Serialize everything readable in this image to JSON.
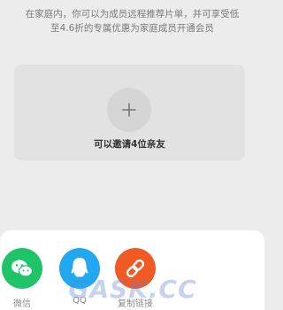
{
  "description": {
    "line1": "在家庭内，你可以为成员远程推荐片单，并可享受低",
    "line2": "至4.6折的专属优惠为家庭成员开通会员"
  },
  "invite": {
    "label": "可以邀请4位亲友",
    "icon": "plus-icon"
  },
  "share_sheet": {
    "options": [
      {
        "label": "微信",
        "icon": "wechat-icon",
        "color": "#1fc468"
      },
      {
        "label": "QQ",
        "icon": "qq-icon",
        "color": "#22a8f0"
      },
      {
        "label": "复制链接",
        "icon": "link-icon",
        "color": "#f15a24"
      }
    ]
  },
  "watermark": {
    "text": "GASK.CC"
  },
  "colors": {
    "background": "#ececec",
    "card": "#e2e2e2",
    "sheet": "#ffffff"
  }
}
